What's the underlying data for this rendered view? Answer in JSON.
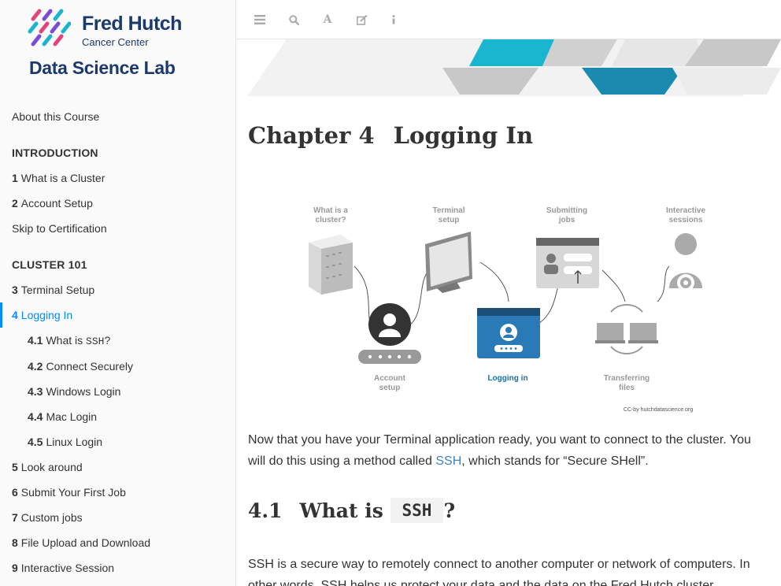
{
  "logo": {
    "org_name": "Fred Hutch",
    "org_sub": "Cancer Center",
    "lab_name": "Data Science Lab"
  },
  "sidebar": {
    "about": "About this Course",
    "intro_header": "INTRODUCTION",
    "items_intro": [
      {
        "num": "1",
        "label": "What is a Cluster"
      },
      {
        "num": "2",
        "label": "Account Setup"
      }
    ],
    "skip": "Skip to Certification",
    "cluster_header": "CLUSTER 101",
    "item_3": {
      "num": "3",
      "label": "Terminal Setup"
    },
    "item_4": {
      "num": "4",
      "label": "Logging In"
    },
    "subitems": [
      {
        "num": "4.1",
        "label": "What is ",
        "code": "SSH",
        "suffix": "?"
      },
      {
        "num": "4.2",
        "label": "Connect Securely"
      },
      {
        "num": "4.3",
        "label": "Windows Login"
      },
      {
        "num": "4.4",
        "label": "Mac Login"
      },
      {
        "num": "4.5",
        "label": "Linux Login"
      }
    ],
    "items_rest": [
      {
        "num": "5",
        "label": "Look around"
      },
      {
        "num": "6",
        "label": "Submit Your First Job"
      },
      {
        "num": "7",
        "label": "Custom jobs"
      },
      {
        "num": "8",
        "label": "File Upload and Download"
      },
      {
        "num": "9",
        "label": "Interactive Session"
      }
    ]
  },
  "toolbar": {
    "icons": [
      "toggle-sidebar-icon",
      "search-icon",
      "font-settings-icon",
      "edit-icon",
      "info-icon"
    ]
  },
  "main": {
    "chapter_num": "Chapter 4",
    "chapter_title": "Logging In",
    "figure": {
      "labels": {
        "what_is_cluster": [
          "What is a",
          "cluster?"
        ],
        "terminal_setup": [
          "Terminal",
          "setup"
        ],
        "submitting_jobs": [
          "Submitting",
          "jobs"
        ],
        "interactive_sessions": [
          "Interactive",
          "sessions"
        ],
        "account_setup": [
          "Account",
          "setup"
        ],
        "logging_in": "Logging in",
        "transferring_files": [
          "Transferring",
          "files"
        ],
        "credit": "CC-by hutchdatascience.org"
      }
    },
    "para1_a": "Now that you have your Terminal application ready, you want to connect to the cluster. You will do this using a method called ",
    "para1_link": "SSH",
    "para1_b": ", which stands for “Secure SHell”.",
    "section_num": "4.1",
    "section_label": "What is",
    "section_code": "SSH",
    "section_suffix": "?",
    "para2": "SSH is a secure way to remotely connect to another computer or network of computers. In other words, SSH helps us protect your data and the data on the Fred Hutch cluster."
  },
  "colors": {
    "accent": "#008cff",
    "link": "#4183c4",
    "brand_navy": "#1b3a6b",
    "teal": "#1ab6d0",
    "gray_shape": "#c8c8c8"
  }
}
